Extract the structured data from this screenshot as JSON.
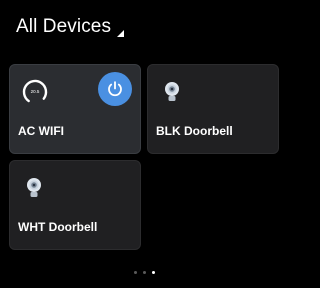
{
  "header": {
    "title": "All Devices",
    "dropdown_icon": "caret-down-icon"
  },
  "devices": [
    {
      "name": "AC WIFI",
      "type": "air-conditioner",
      "icon": "thermostat-dial-icon",
      "dial_value": "20.5",
      "power_icon": "power-icon",
      "power_state": "on",
      "accent_color": "#4a90e2",
      "selected": true
    },
    {
      "name": "BLK Doorbell",
      "type": "doorbell",
      "icon": "doorbell-camera-icon"
    },
    {
      "name": "WHT Doorbell",
      "type": "doorbell",
      "icon": "doorbell-camera-icon"
    }
  ],
  "pager": {
    "pages": 3,
    "current": 3
  },
  "colors": {
    "background": "#000000",
    "card": "#202022",
    "card_selected": "#2b2d31",
    "accent": "#4a90e2"
  }
}
